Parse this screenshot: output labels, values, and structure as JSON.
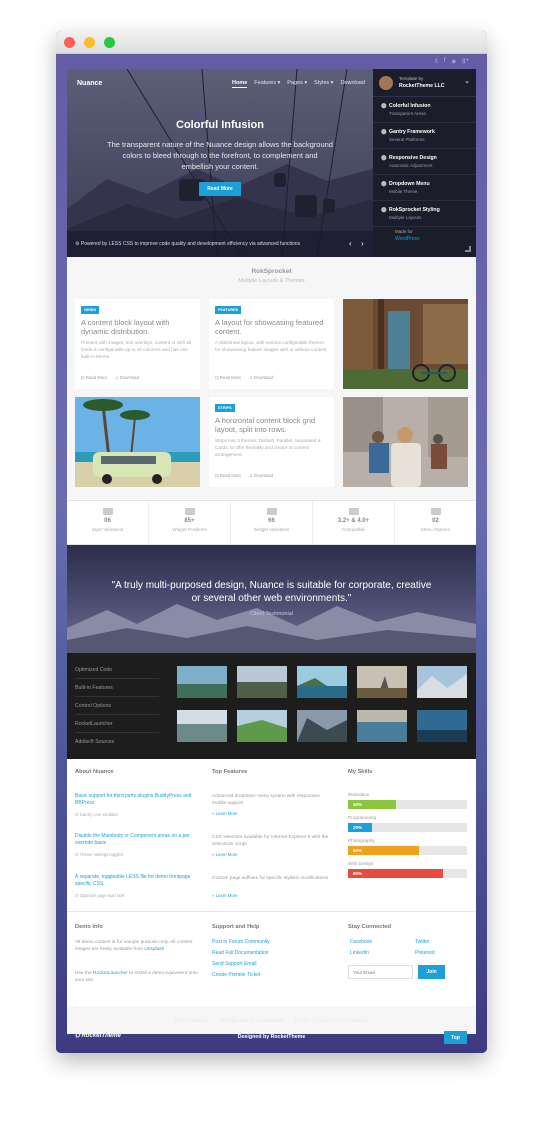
{
  "window": {
    "buttons": {
      "close": "#fc5f57",
      "minimize": "#fdbc2e",
      "zoom": "#28c840"
    }
  },
  "social": [
    "𝕥",
    "f",
    "◈",
    "g+"
  ],
  "header": {
    "logo": "Nuance",
    "nav": [
      "Home",
      "Features ▾",
      "Pages ▾",
      "Styles ▾",
      "Download"
    ],
    "hero_title": "Colorful Infusion",
    "hero_desc": "The transparent nature of the Nuance design allows the background colors to bleed through to the forefront, to complement and embellish your content.",
    "hero_button": "Read More",
    "hero_bar": "⚙ Powered by LESS CSS to improve code quality and development efficiency via advanced functions",
    "prev": "‹",
    "next": "›"
  },
  "sidepanel": {
    "template_label": "Template by",
    "template_author": "RocketTheme LLC",
    "items": [
      {
        "title": "Colorful Infusion",
        "sub": "Transparent Areas"
      },
      {
        "title": "Gantry Framework",
        "sub": "Several Platforms"
      },
      {
        "title": "Responsive Design",
        "sub": "Automatic Adjustment"
      },
      {
        "title": "Dropdown Menu",
        "sub": "Mobile Theme"
      },
      {
        "title": "RokSprocket Styling",
        "sub": "Multiple Layouts"
      }
    ],
    "made_for": "Made for",
    "made_for_link": "WordPress"
  },
  "roksprocket": {
    "title": "RokSprocket",
    "subtitle": "Multiple Layouts & Themes",
    "cards": [
      {
        "badge": "GRIDS",
        "title": "A content block layout with dynamic distribution.",
        "desc": "Present with images, text overlays, content or with all. Grids is configurable up to 10 columns and has one built-in theme.",
        "read": "⊡ Read More",
        "download": "⇩ Download"
      },
      {
        "badge": "FEATURES",
        "title": "A layout for showcasing featured content.",
        "desc": "A slideshow layout, with various configurable themes for showcasing feature images with or without content.",
        "read": "⊡ Read More",
        "download": "⇩ Download"
      },
      {
        "badge": "STRIPS",
        "title": "A horizontal content block grid layout, split into rows.",
        "desc": "Strips has 3 themes: Default, Parallel, Separated & Cards; to offer flexibility and choice in content arrangement.",
        "read": "⊡ Read More",
        "download": "⇩ Download"
      }
    ]
  },
  "stats": [
    {
      "num": "06",
      "label": "Style Variations"
    },
    {
      "num": "85+",
      "label": "Widget Positions"
    },
    {
      "num": "66",
      "label": "Widget Variations"
    },
    {
      "num": "3.2+ & 4.0+",
      "label": "Compatible"
    },
    {
      "num": "02",
      "label": "Menu Options"
    }
  ],
  "testimonial": {
    "quote": "\"A truly multi-purposed design, Nuance is suitable for corporate, creative or several other web environments.\"",
    "author": "Client Testimonial"
  },
  "showcase": {
    "items": [
      "Optimized Code",
      "Built-in Features",
      "Control Options",
      "RocketLauncher",
      "Adobe® Sources"
    ]
  },
  "about": {
    "heading": "About Nuance",
    "links": [
      {
        "text": "Basic support for third party plugins BuddyPress and BBPress",
        "note": "⊡ Gantry core enabled"
      },
      {
        "text": "Disable the Mainbody or Component areas on a per override basis",
        "note": "⊡ Theme settings toggles"
      },
      {
        "text": "A separate, toggleable LESS file for demo frontpage specific CSS",
        "note": "⊡ Optimize page load size"
      }
    ]
  },
  "features": {
    "heading": "Top Features",
    "items": [
      {
        "text": "Advanced dropdown menu system with responsive mobile support",
        "link": "» Learn More"
      },
      {
        "text": "CSS selectors available for Internet Explorer 8 with the Selectivizr script",
        "link": "» Learn More"
      },
      {
        "text": "Custom page suffixes for specific stylistic modifications",
        "link": "» Learn More"
      }
    ]
  },
  "skills": {
    "heading": "My Skills",
    "items": [
      {
        "name": "Illustration",
        "value": 40,
        "label": "40%",
        "color": "#8cc63f"
      },
      {
        "name": "Programming",
        "value": 20,
        "label": "20%",
        "color": "#1d9fd8"
      },
      {
        "name": "Photography",
        "value": 60,
        "label": "60%",
        "color": "#f0a120"
      },
      {
        "name": "Web Design",
        "value": 80,
        "label": "80%",
        "color": "#e84c3d"
      }
    ]
  },
  "demo": {
    "heading": "Demo Info",
    "p1_pre": "All demo content is for sample purpose only. All content images are freely available from ",
    "p1_link": "Unsplash",
    "p1_post": ".",
    "p2_pre": "Use the ",
    "p2_link": "RocketLauncher",
    "p2_post": " to install a demo equivalent onto your site."
  },
  "support": {
    "heading": "Support and Help",
    "links": [
      "Post in Forum Community",
      "Read Full Documentation",
      "Send Support Email",
      "Create Premier Ticket"
    ]
  },
  "connected": {
    "heading": "Stay Connected",
    "links": [
      "Facebook",
      "Twitter",
      "LinkedIn",
      "Pinterest"
    ],
    "email_placeholder": "Your Email",
    "join": "Join"
  },
  "footer": {
    "links": [
      "About Nuance",
      "Tutorials and Documentation",
      "Forum Support and Community"
    ],
    "logo": "RocketTheme",
    "designed": "Designed by RocketTheme",
    "top": "Top"
  }
}
